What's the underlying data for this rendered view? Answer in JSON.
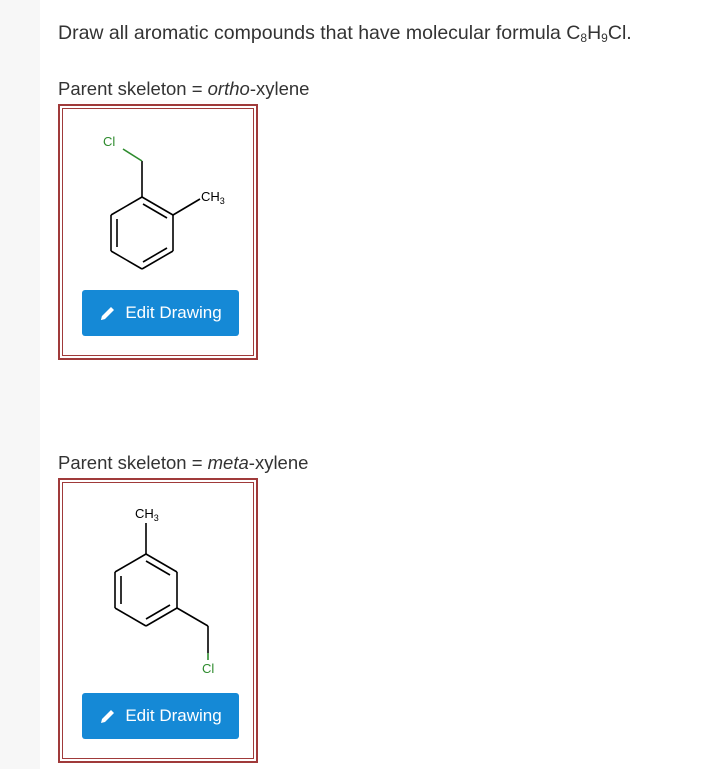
{
  "question": {
    "prefix": "Draw all aromatic compounds that have molecular formula C",
    "sub1": "8",
    "mid": "H",
    "sub2": "9",
    "suffix": "Cl."
  },
  "sections": [
    {
      "label_prefix": "Parent skeleton = ",
      "label_italic": "ortho",
      "label_suffix": "-xylene",
      "atom_cl": "Cl",
      "atom_ch3": "CH",
      "atom_ch3_sub": "3",
      "button_label": "Edit Drawing",
      "button_icon": "pencil-icon"
    },
    {
      "label_prefix": "Parent skeleton = ",
      "label_italic": "meta",
      "label_suffix": "-xylene",
      "atom_cl": "Cl",
      "atom_ch3": "CH",
      "atom_ch3_sub": "3",
      "button_label": "Edit Drawing",
      "button_icon": "pencil-icon"
    }
  ],
  "colors": {
    "button_bg": "#1589d6",
    "box_border": "#a03a3a",
    "chlorine": "#2e8b2e"
  }
}
